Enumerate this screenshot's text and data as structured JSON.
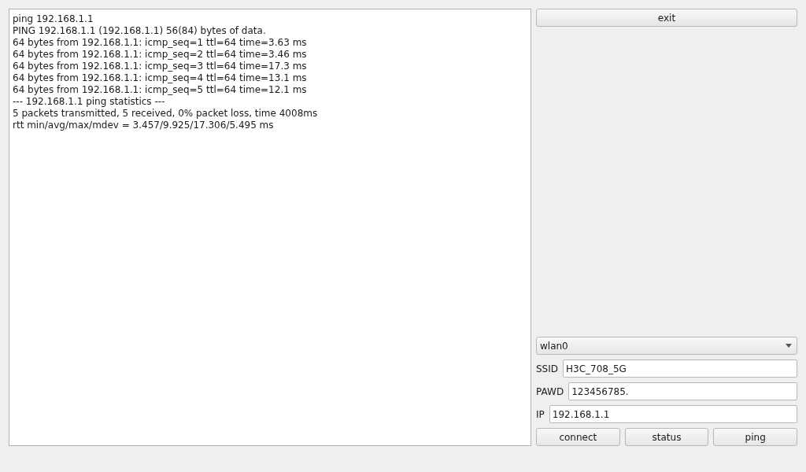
{
  "output_log": [
    "ping 192.168.1.1",
    "PING 192.168.1.1 (192.168.1.1) 56(84) bytes of data.",
    "64 bytes from 192.168.1.1: icmp_seq=1 ttl=64 time=3.63 ms",
    "64 bytes from 192.168.1.1: icmp_seq=2 ttl=64 time=3.46 ms",
    "64 bytes from 192.168.1.1: icmp_seq=3 ttl=64 time=17.3 ms",
    "64 bytes from 192.168.1.1: icmp_seq=4 ttl=64 time=13.1 ms",
    "64 bytes from 192.168.1.1: icmp_seq=5 ttl=64 time=12.1 ms",
    "--- 192.168.1.1 ping statistics ---",
    "5 packets transmitted, 5 received, 0% packet loss, time 4008ms",
    "rtt min/avg/max/mdev = 3.457/9.925/17.306/5.495 ms"
  ],
  "exit_button": "exit",
  "interface_select": {
    "value": "wlan0"
  },
  "fields": [
    {
      "label": "SSID",
      "value": "H3C_708_5G"
    },
    {
      "label": "PAWD",
      "value": "123456785."
    },
    {
      "label": "IP",
      "value": "192.168.1.1"
    }
  ],
  "buttons": [
    "connect",
    "status",
    "ping"
  ]
}
